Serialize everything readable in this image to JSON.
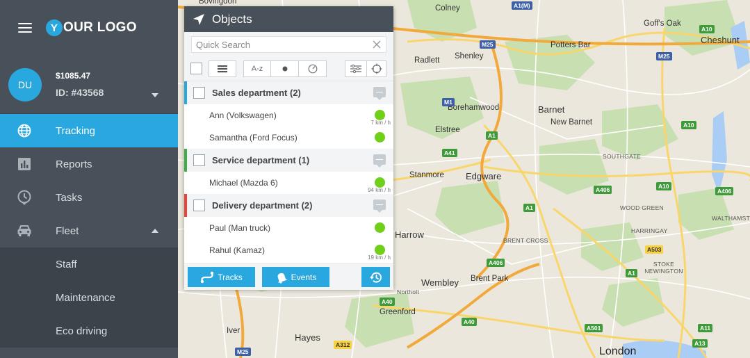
{
  "sidebar": {
    "logo_letter": "Y",
    "logo_text": "OUR LOGO",
    "avatar_initials": "DU",
    "balance": "$1085.47",
    "account_id": "ID: #43568",
    "nav": [
      {
        "label": "Tracking",
        "icon": "globe-icon",
        "active": true
      },
      {
        "label": "Reports",
        "icon": "bar-chart-icon"
      },
      {
        "label": "Tasks",
        "icon": "clock-icon"
      },
      {
        "label": "Fleet",
        "icon": "car-icon"
      }
    ],
    "fleet_sub": [
      "Staff",
      "Maintenance",
      "Eco driving"
    ]
  },
  "panel": {
    "title": "Objects",
    "search_placeholder": "Quick Search",
    "sort_label": "A-z",
    "groups": [
      {
        "title": "Sales department (2)",
        "color": "#29a8e0",
        "objects": [
          {
            "name": "Ann (Volkswagen)",
            "speed": "7 km / h"
          },
          {
            "name": "Samantha (Ford Focus)",
            "speed": ""
          }
        ]
      },
      {
        "title": "Service department (1)",
        "color": "#3fae49",
        "objects": [
          {
            "name": "Michael (Mazda 6)",
            "speed": "94 km / h"
          }
        ]
      },
      {
        "title": "Delivery department (2)",
        "color": "#e8463b",
        "objects": [
          {
            "name": "Paul (Man truck)",
            "speed": ""
          },
          {
            "name": "Rahul (Kamaz)",
            "speed": "19 km / h"
          }
        ]
      }
    ],
    "footer": {
      "tracks_label": "Tracks",
      "events_label": "Events"
    }
  },
  "map": {
    "places": [
      "Bovingdon",
      "Colney",
      "Goff's Oak",
      "Cheshunt",
      "Potters Bar",
      "Shenley",
      "Radlett",
      "Borehamwood",
      "Barnet",
      "New Barnet",
      "Elstree",
      "Edgware",
      "Stanmore",
      "SOUTHGATE",
      "WOOD GREEN",
      "WALTHAMSTOW",
      "HARRINGAY",
      "BRENT CROSS",
      "STOKE NEWINGTON",
      "Harrow",
      "Brent Park",
      "Wembley",
      "Northolt",
      "Greenford",
      "Iver",
      "Hayes",
      "London"
    ],
    "roads": [
      "A1(M)",
      "M25",
      "A10",
      "M1",
      "A41",
      "A1",
      "A406",
      "A503",
      "A1",
      "A406",
      "A40",
      "A40",
      "A501",
      "A11",
      "A13",
      "A312",
      "M25",
      "M25",
      "A10",
      "A10",
      "A1",
      "A406"
    ]
  }
}
